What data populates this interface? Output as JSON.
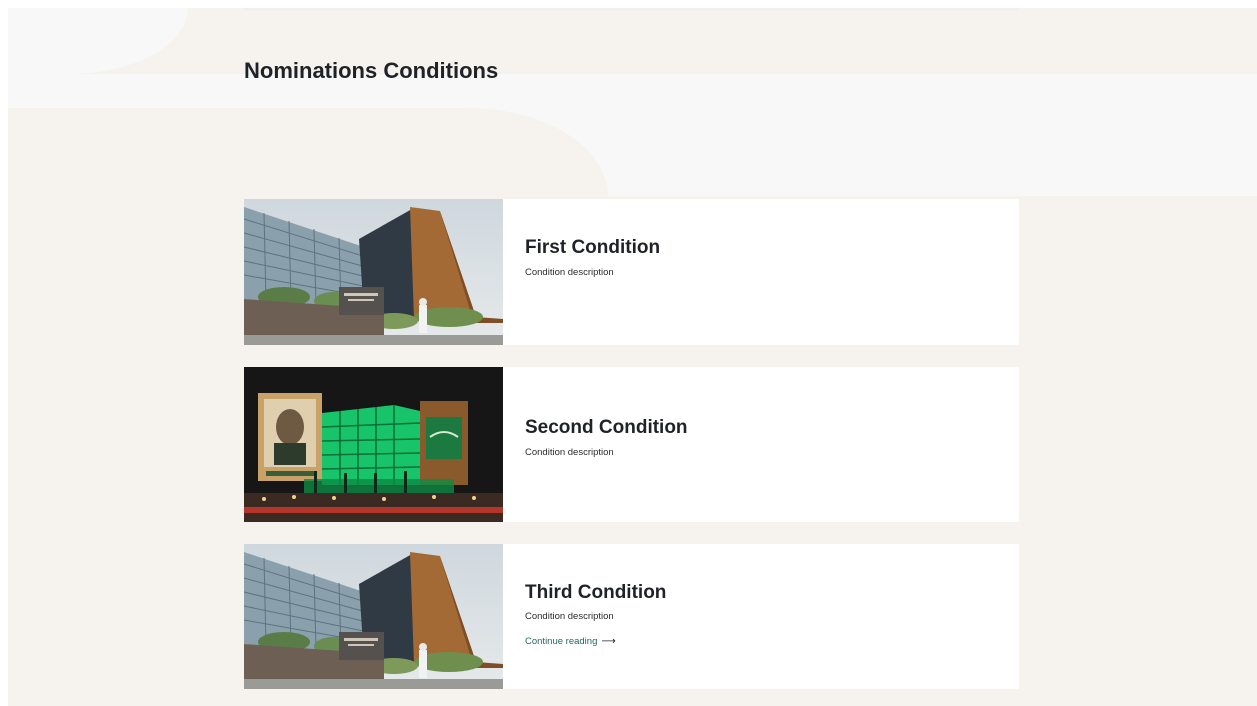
{
  "page": {
    "title": "Nominations Conditions"
  },
  "conditions": [
    {
      "title": "First Condition",
      "description": "Condition description",
      "image": "building-daytime-photo"
    },
    {
      "title": "Second Condition",
      "description": "Condition description",
      "image": "building-night-green-lights-photo"
    },
    {
      "title": "Third Condition",
      "description": "Condition description",
      "image": "building-daytime-photo",
      "link": "Continue reading"
    }
  ],
  "icons": {
    "continue_arrow": "arrow-right-icon"
  },
  "colors": {
    "background": "#f6f3ef",
    "card": "#ffffff",
    "link": "#1f6b5d",
    "heading": "#1f2328"
  }
}
